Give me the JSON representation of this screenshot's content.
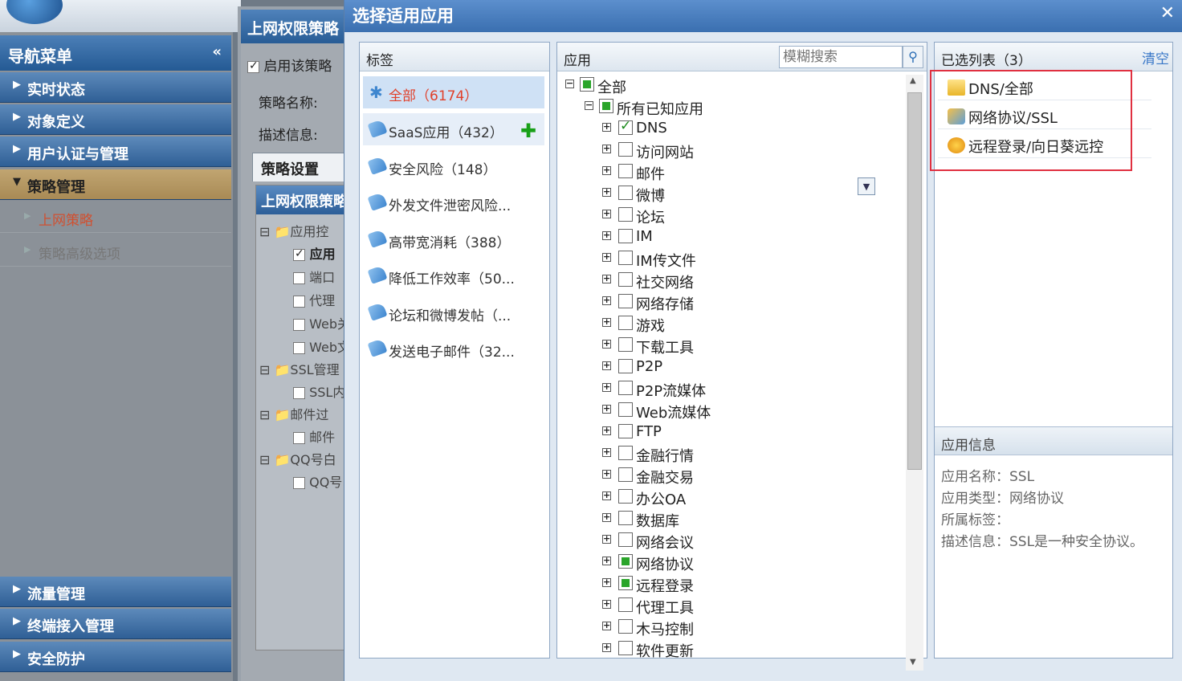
{
  "nav": {
    "title": "导航菜单",
    "collapse": "«",
    "items_top": [
      "实时状态",
      "对象定义",
      "用户认证与管理"
    ],
    "active": "策略管理",
    "subs": [
      "上网策略",
      "策略高级选项"
    ],
    "items_bottom": [
      "流量管理",
      "终端接入管理",
      "安全防护"
    ]
  },
  "page": {
    "title": "上网权限策略",
    "enable": "启用该策略",
    "name_label": "策略名称:",
    "desc_label": "描述信息:",
    "tab": "策略设置",
    "tree_title": "上网权限策略",
    "tree": [
      "应用控",
      "应用",
      "端口",
      "代理",
      "Web关",
      "Web文",
      "SSL管理",
      "SSL内",
      "邮件过",
      "邮件",
      "QQ号白",
      "QQ号"
    ]
  },
  "dialog": {
    "title": "选择适用应用",
    "close": "✕",
    "tags_header": "标签",
    "tags": [
      "全部（6174）",
      "SaaS应用（432）",
      "安全风险（148）",
      "外发文件泄密风险...",
      "高带宽消耗（388）",
      "降低工作效率（50...",
      "论坛和微博发帖（...",
      "发送电子邮件（32..."
    ],
    "apps_header": "应用",
    "search_placeholder": "模糊搜索",
    "tree_root": "全部",
    "tree_known": "所有已知应用",
    "apps": [
      "DNS",
      "访问网站",
      "邮件",
      "微博",
      "论坛",
      "IM",
      "IM传文件",
      "社交网络",
      "网络存储",
      "游戏",
      "下载工具",
      "P2P",
      "P2P流媒体",
      "Web流媒体",
      "FTP",
      "金融行情",
      "金融交易",
      "办公OA",
      "数据库",
      "网络会议",
      "网络协议",
      "远程登录",
      "代理工具",
      "木马控制",
      "软件更新"
    ],
    "app_states": [
      "on",
      "",
      "",
      "",
      "",
      "",
      "",
      "",
      "",
      "",
      "",
      "",
      "",
      "",
      "",
      "",
      "",
      "",
      "",
      "",
      "part",
      "part",
      "",
      "",
      ""
    ],
    "selected_header": "已选列表（3）",
    "clear": "清空",
    "selected": [
      "DNS/全部",
      "网络协议/SSL",
      "远程登录/向日葵远控"
    ],
    "info_header": "应用信息",
    "info": [
      "应用名称：SSL",
      "应用类型：网络协议",
      "所属标签：",
      "描述信息：SSL是一种安全协议。"
    ]
  },
  "colors": {
    "accent": "#3a6fb0",
    "selected_tag_text": "#e0402a",
    "check_green": "#2aa52a",
    "highlight_box": "#e03040"
  }
}
